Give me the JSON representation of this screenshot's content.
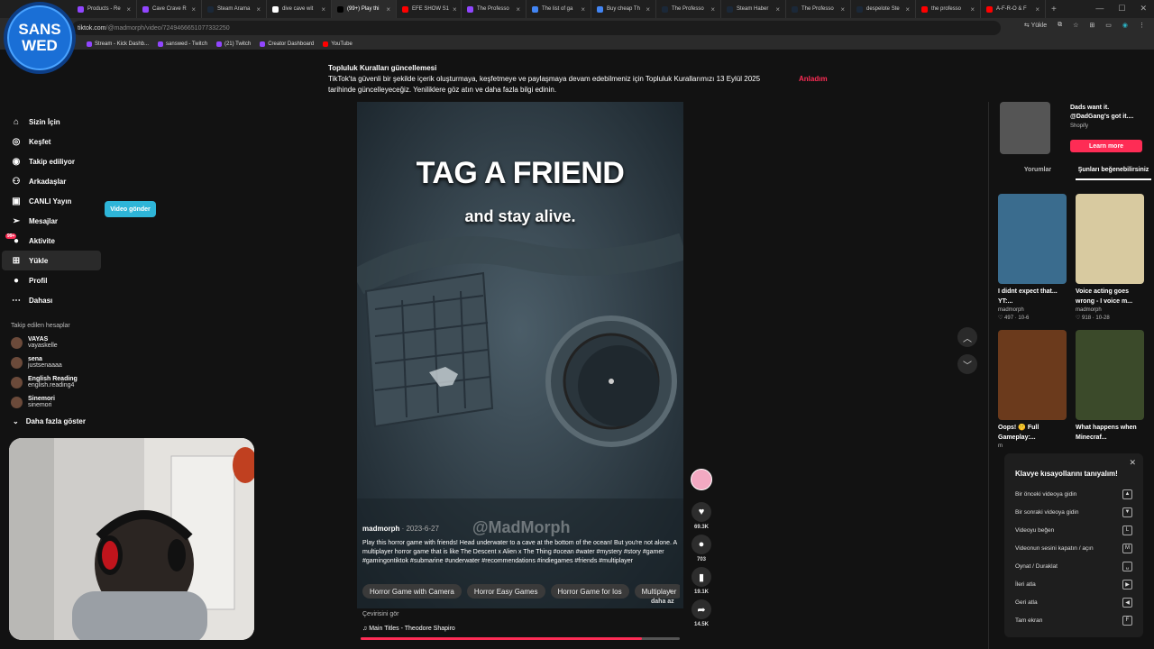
{
  "browser": {
    "tabs": [
      {
        "label": "Products - Re",
        "color": "#9146ff"
      },
      {
        "label": "Cave Crave R",
        "color": "#9146ff"
      },
      {
        "label": "Steam Arama",
        "color": "#1b2838"
      },
      {
        "label": "dive cave wit",
        "color": "#ffffff"
      },
      {
        "label": "(99+) Play thi",
        "color": "#000000",
        "active": true
      },
      {
        "label": "EFE SHOW S1",
        "color": "#ff0000"
      },
      {
        "label": "The Professo",
        "color": "#9146ff"
      },
      {
        "label": "The list of ga",
        "color": "#4285f4"
      },
      {
        "label": "Buy cheap Th",
        "color": "#4285f4"
      },
      {
        "label": "The Professo",
        "color": "#1b2838"
      },
      {
        "label": "Steam Haber",
        "color": "#1b2838"
      },
      {
        "label": "The Professo",
        "color": "#1b2838"
      },
      {
        "label": "despelote Ste",
        "color": "#1b2838"
      },
      {
        "label": "the professo",
        "color": "#ff0000"
      },
      {
        "label": "A-F-R-O & F",
        "color": "#ff0000"
      }
    ],
    "url_host": "tiktok.com",
    "url_path": "/@madmorph/video/7249466651077332250",
    "translate_label": "Yükle",
    "bookmarks": [
      "Stream - Kick Dashb...",
      "sanswed - Twitch",
      "(21) Twitch",
      "Creator Dashboard",
      "YouTube"
    ]
  },
  "logo": {
    "line1": "SANS",
    "line2": "WED"
  },
  "sidebar": {
    "items": [
      {
        "label": "Sizin İçin",
        "icon": "home-icon"
      },
      {
        "label": "Keşfet",
        "icon": "compass-icon"
      },
      {
        "label": "Takip ediliyor",
        "icon": "following-icon"
      },
      {
        "label": "Arkadaşlar",
        "icon": "friends-icon"
      },
      {
        "label": "CANLI Yayın",
        "icon": "live-icon"
      },
      {
        "label": "Mesajlar",
        "icon": "messages-icon"
      },
      {
        "label": "Aktivite",
        "icon": "activity-icon",
        "badge": "99+"
      },
      {
        "label": "Yükle",
        "icon": "upload-icon"
      },
      {
        "label": "Profil",
        "icon": "profile-icon"
      },
      {
        "label": "Dahası",
        "icon": "more-icon"
      }
    ],
    "upload_button": "Video gönder",
    "following_title": "Takip edilen hesaplar",
    "following": [
      {
        "name": "VAYAS",
        "handle": "vayaskelle"
      },
      {
        "name": "sena",
        "handle": "justsenaaaa"
      },
      {
        "name": "English Reading",
        "handle": "english.reading4"
      },
      {
        "name": "Sinemori",
        "handle": "sinemori"
      }
    ],
    "show_more": "Daha fazla göster"
  },
  "notice": {
    "title": "Topluluk Kuralları güncellemesi",
    "body": "TikTok'ta güvenli bir şekilde içerik oluşturmaya, keşfetmeye ve paylaşmaya devam edebilmeniz için Topluluk Kurallarımızı 13 Eylül 2025 tarihinde güncelleyeceğiz. Yeniliklere göz atın ve daha fazla bilgi edinin.",
    "link": "Anladım"
  },
  "video": {
    "overlay_title": "TAG A FRIEND",
    "overlay_sub": "and stay alive.",
    "watermark": "@MadMorph",
    "author": "madmorph",
    "date": "2023-6-27",
    "description": "Play this horror game with friends! Head underwater to a cave at the bottom of the ocean! But you're not alone. A multiplayer horror game that is like The Descent x Alien x The Thing #ocean #water #mystery #story #gamer #gamingontiktok #submarine #underwater #recommendations #indiegames #friends #multiplayer",
    "chips": [
      "Horror Game with Camera",
      "Horror Easy Games",
      "Horror Game for Ios",
      "Multiplayer"
    ],
    "more": "daha az",
    "translate": "Çevirisini gör",
    "music": "Main Titles - Theodore Shapiro",
    "progress": 0.88,
    "likes": "69.3K",
    "comments": "703",
    "saves": "19.1K",
    "shares": "14.5K"
  },
  "right": {
    "ad": {
      "text1": "Dads want it.",
      "text2": "@DadGang's got it....",
      "sponsor": "Shopify",
      "button": "Learn more"
    },
    "tabs": [
      "Yorumlar",
      "Şunları beğenebilirsiniz"
    ],
    "cards": [
      {
        "title": "I didnt expect that... YT:...",
        "author": "madmorph",
        "stats": "♡ 497 · 10-6",
        "color": "#3a6c8e"
      },
      {
        "title": "Voice acting goes wrong - I voice m...",
        "author": "madmorph",
        "stats": "♡ 918 · 10-28",
        "color": "#d8caa0"
      },
      {
        "title": "Oops! 🤫 Full Gameplay:...",
        "author": "m",
        "stats": "",
        "color": "#6b3a1c"
      },
      {
        "title": "What happens when Minecraf...",
        "author": "",
        "stats": "",
        "color": "#3b4a2a"
      }
    ]
  },
  "shortcuts": {
    "title": "Klavye kısayollarını tanıyalım!",
    "rows": [
      {
        "label": "Bir önceki videoya gidin",
        "key": "▲"
      },
      {
        "label": "Bir sonraki videoya gidin",
        "key": "▼"
      },
      {
        "label": "Videoyu beğen",
        "key": "L"
      },
      {
        "label": "Videonun sesini kapatın / açın",
        "key": "M"
      },
      {
        "label": "Oynat / Duraklat",
        "key": "␣"
      },
      {
        "label": "İleri atla",
        "key": "▶"
      },
      {
        "label": "Geri atla",
        "key": "◀"
      },
      {
        "label": "Tam ekran",
        "key": "F"
      }
    ]
  }
}
